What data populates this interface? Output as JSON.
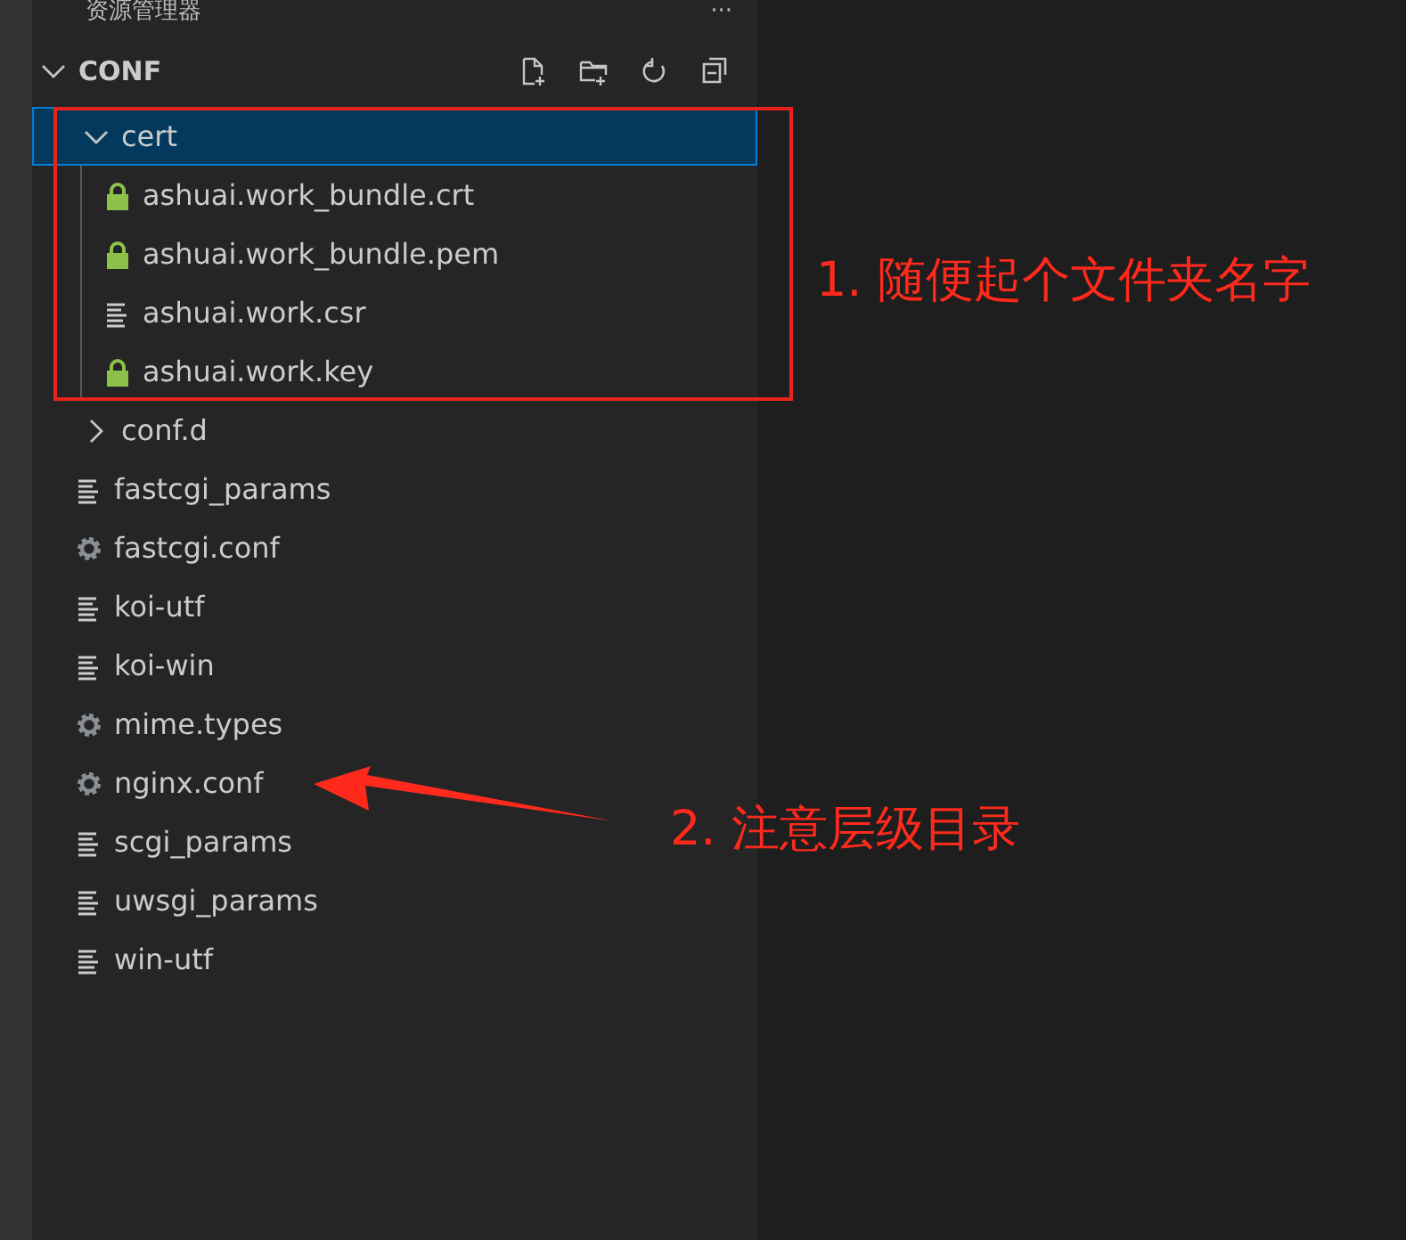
{
  "explorer": {
    "title": "资源管理器",
    "more": "···"
  },
  "section": {
    "title": "CONF",
    "expanded": true
  },
  "tree": [
    {
      "label": "cert",
      "kind": "folder",
      "selected": true,
      "expanded": true,
      "children": [
        {
          "label": "ashuai.work_bundle.crt",
          "kind": "locked-file",
          "selected": false
        },
        {
          "label": "ashuai.work_bundle.pem",
          "kind": "locked-file",
          "selected": false
        },
        {
          "label": "ashuai.work.csr",
          "kind": "text-file",
          "selected": false
        },
        {
          "label": "ashuai.work.key",
          "kind": "locked-file",
          "selected": false
        }
      ]
    },
    {
      "label": "conf.d",
      "kind": "folder",
      "selected": false,
      "expanded": false
    },
    {
      "label": "fastcgi_params",
      "kind": "text-file",
      "selected": false
    },
    {
      "label": "fastcgi.conf",
      "kind": "config-file",
      "selected": false
    },
    {
      "label": "koi-utf",
      "kind": "text-file",
      "selected": false
    },
    {
      "label": "koi-win",
      "kind": "text-file",
      "selected": false
    },
    {
      "label": "mime.types",
      "kind": "config-file",
      "selected": false
    },
    {
      "label": "nginx.conf",
      "kind": "config-file",
      "selected": false
    },
    {
      "label": "scgi_params",
      "kind": "text-file",
      "selected": false
    },
    {
      "label": "uwsgi_params",
      "kind": "text-file",
      "selected": false
    },
    {
      "label": "win-utf",
      "kind": "text-file",
      "selected": false
    }
  ],
  "annotations": [
    {
      "kind": "box-note",
      "text": "1. 随便起个文件夹名字"
    },
    {
      "kind": "arrow-note",
      "text": "2. 注意层级目录"
    }
  ]
}
